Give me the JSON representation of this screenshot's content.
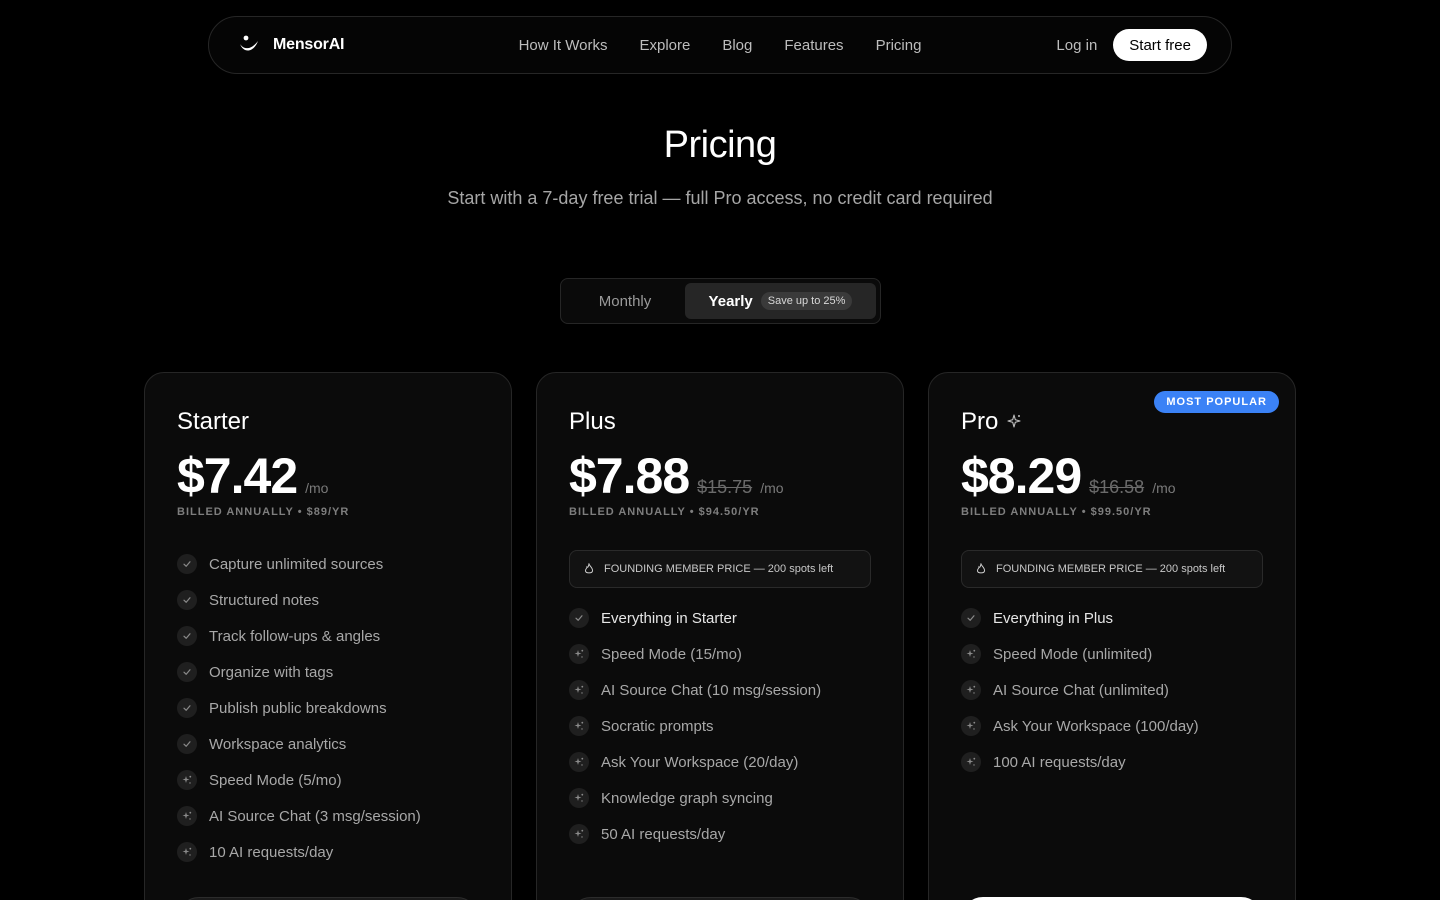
{
  "nav": {
    "brand": "MensorAI",
    "links": [
      "How It Works",
      "Explore",
      "Blog",
      "Features",
      "Pricing"
    ],
    "login": "Log in",
    "start": "Start free"
  },
  "header": {
    "title": "Pricing",
    "subtitle": "Start with a 7-day free trial — full Pro access, no credit card required"
  },
  "toggle": {
    "monthly": "Monthly",
    "yearly": "Yearly",
    "save": "Save up to 25%",
    "selected": "Yearly"
  },
  "plans": [
    {
      "name": "Starter",
      "price": "$7.42",
      "per": "/mo",
      "billed": "BILLED ANNUALLY • $89/YR",
      "features": [
        {
          "text": "Capture unlimited sources",
          "icon": "check-icon"
        },
        {
          "text": "Structured notes",
          "icon": "check-icon"
        },
        {
          "text": "Track follow-ups & angles",
          "icon": "check-icon"
        },
        {
          "text": "Organize with tags",
          "icon": "check-icon"
        },
        {
          "text": "Publish public breakdowns",
          "icon": "check-icon"
        },
        {
          "text": "Workspace analytics",
          "icon": "check-icon"
        },
        {
          "text": "Speed Mode (5/mo)",
          "icon": "sparkle-icon"
        },
        {
          "text": "AI Source Chat (3 msg/session)",
          "icon": "sparkle-icon"
        },
        {
          "text": "10 AI requests/day",
          "icon": "sparkle-icon"
        }
      ]
    },
    {
      "name": "Plus",
      "price": "$7.88",
      "old_price": "$15.75",
      "per": "/mo",
      "billed": "BILLED ANNUALLY • $94.50/YR",
      "founding": "FOUNDING MEMBER PRICE — 200 spots left",
      "features": [
        {
          "text": "Everything in Starter",
          "icon": "check-icon"
        },
        {
          "text": "Speed Mode (15/mo)",
          "icon": "sparkle-icon"
        },
        {
          "text": "AI Source Chat (10 msg/session)",
          "icon": "sparkle-icon"
        },
        {
          "text": "Socratic prompts",
          "icon": "sparkle-icon"
        },
        {
          "text": "Ask Your Workspace (20/day)",
          "icon": "sparkle-icon"
        },
        {
          "text": "Knowledge graph syncing",
          "icon": "sparkle-icon"
        },
        {
          "text": "50 AI requests/day",
          "icon": "sparkle-icon"
        }
      ]
    },
    {
      "name": "Pro",
      "price": "$8.29",
      "old_price": "$16.58",
      "per": "/mo",
      "billed": "BILLED ANNUALLY • $99.50/YR",
      "badge": "MOST POPULAR",
      "founding": "FOUNDING MEMBER PRICE — 200 spots left",
      "features": [
        {
          "text": "Everything in Plus",
          "icon": "check-icon"
        },
        {
          "text": "Speed Mode (unlimited)",
          "icon": "sparkle-icon"
        },
        {
          "text": "AI Source Chat (unlimited)",
          "icon": "sparkle-icon"
        },
        {
          "text": "Ask Your Workspace (100/day)",
          "icon": "sparkle-icon"
        },
        {
          "text": "100 AI requests/day",
          "icon": "sparkle-icon"
        }
      ]
    }
  ],
  "colors": {
    "background": "#000000",
    "accent_badge": "#3b82f6",
    "muted_text": "#a8a8a8"
  }
}
